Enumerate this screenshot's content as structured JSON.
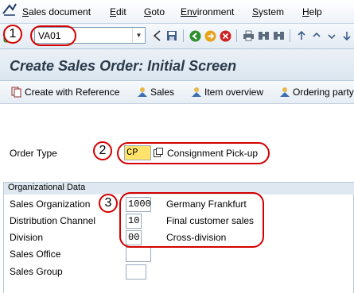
{
  "menu": {
    "items": [
      {
        "label": "Sales document",
        "key": "S",
        "rest": "ales document"
      },
      {
        "label": "Edit",
        "key": "E",
        "rest": "dit"
      },
      {
        "label": "Goto",
        "key": "G",
        "rest": "oto"
      },
      {
        "label": "Environment",
        "key": "Env",
        "rest": "ironment"
      },
      {
        "label": "System",
        "key": "S",
        "rest": "ystem"
      },
      {
        "label": "Help",
        "key": "H",
        "rest": "elp"
      }
    ]
  },
  "toolbar": {
    "command_value": "VA01"
  },
  "title": "Create Sales Order: Initial Screen",
  "app_toolbar": {
    "create_with_reference": "Create with Reference",
    "sales": "Sales",
    "item_overview": "Item overview",
    "ordering_party": "Ordering party"
  },
  "order_type": {
    "label": "Order Type",
    "value": "CP",
    "description": "Consignment Pick-up"
  },
  "org_data": {
    "title": "Organizational Data",
    "sales_org": {
      "label": "Sales Organization",
      "value": "1000",
      "description": "Germany Frankfurt"
    },
    "dist_channel": {
      "label": "Distribution Channel",
      "value": "10",
      "description": "Final customer sales"
    },
    "division": {
      "label": "Division",
      "value": "00",
      "description": "Cross-division"
    },
    "sales_office": {
      "label": "Sales Office",
      "value": ""
    },
    "sales_group": {
      "label": "Sales Group",
      "value": ""
    }
  },
  "annotations": {
    "step1": "1",
    "step2": "2",
    "step3": "3"
  },
  "colors": {
    "annotation_red": "#d40000",
    "highlight_yellow": "#ffe36b"
  }
}
